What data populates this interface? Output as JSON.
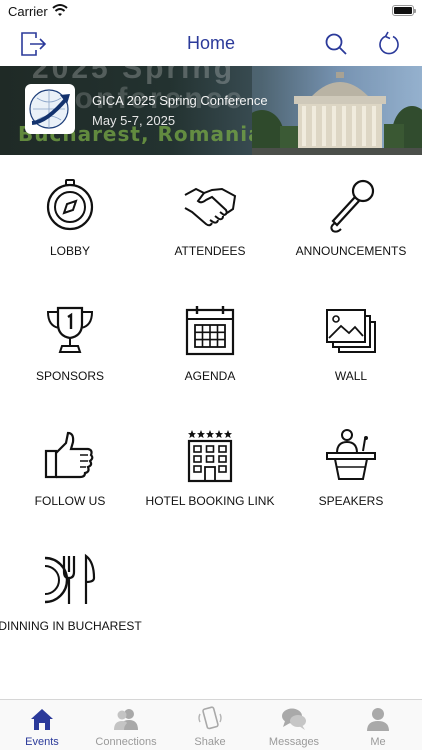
{
  "status_bar": {
    "carrier": "Carrier"
  },
  "nav": {
    "title": "Home",
    "logout_icon": "logout-icon",
    "search_icon": "search-icon",
    "refresh_icon": "refresh-icon",
    "accent_color": "#2b3a9a"
  },
  "banner": {
    "title": "GICA 2025 Spring Conference",
    "date": "May 5-7, 2025",
    "background_text_line1": "2025 Spring",
    "background_text_line2": "Conference",
    "background_text_line3": "Bucharest, Romania"
  },
  "menu": [
    {
      "label": "LOBBY",
      "icon": "compass-icon"
    },
    {
      "label": "ATTENDEES",
      "icon": "handshake-icon"
    },
    {
      "label": "ANNOUNCEMENTS",
      "icon": "microphone-icon"
    },
    {
      "label": "SPONSORS",
      "icon": "trophy-icon"
    },
    {
      "label": "AGENDA",
      "icon": "calendar-icon"
    },
    {
      "label": "WALL",
      "icon": "gallery-icon"
    },
    {
      "label": "FOLLOW US",
      "icon": "thumbs-up-icon"
    },
    {
      "label": "HOTEL BOOKING LINK",
      "icon": "hotel-icon"
    },
    {
      "label": "SPEAKERS",
      "icon": "speaker-podium-icon"
    },
    {
      "label": "DINNING IN BUCHAREST",
      "icon": "dining-icon"
    }
  ],
  "tabs": [
    {
      "label": "Events",
      "icon": "home-icon",
      "active": true
    },
    {
      "label": "Connections",
      "icon": "people-icon",
      "active": false
    },
    {
      "label": "Shake",
      "icon": "shake-phone-icon",
      "active": false
    },
    {
      "label": "Messages",
      "icon": "chat-bubbles-icon",
      "active": false
    },
    {
      "label": "Me",
      "icon": "person-icon",
      "active": false
    }
  ]
}
